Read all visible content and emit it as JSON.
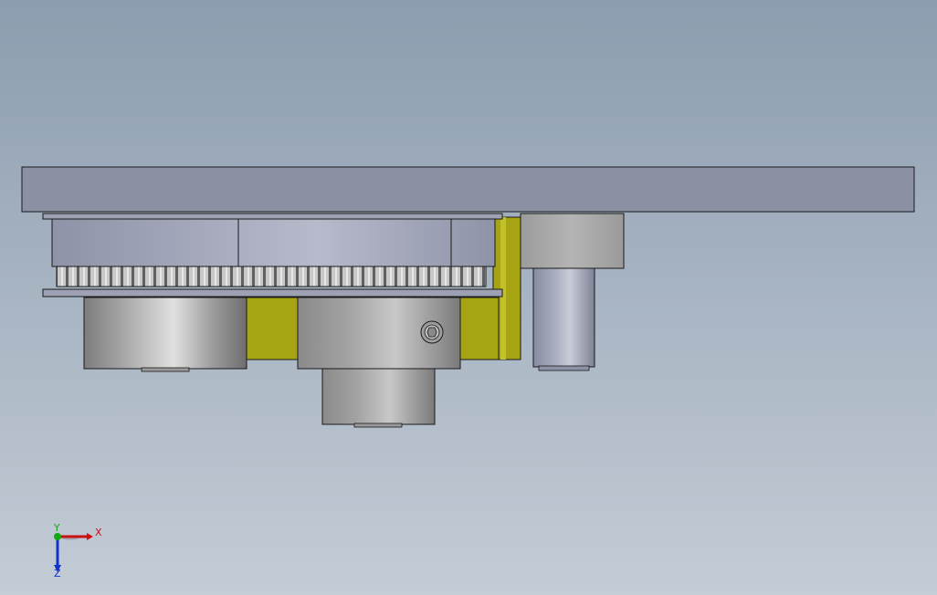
{
  "viewport": {
    "background_top": "#8c9daf",
    "background_bottom": "#c4ccd6"
  },
  "colors": {
    "plate": "#8b90a3",
    "bracket_yellow": "#a7a414",
    "steel": "#b5b5b5",
    "outline": "#1a1a1a"
  },
  "triad": {
    "x_label": "X",
    "y_label": "Y",
    "z_label": "Z",
    "x_color": "#cc1111",
    "y_color": "#11aa11",
    "z_color": "#1133cc"
  }
}
